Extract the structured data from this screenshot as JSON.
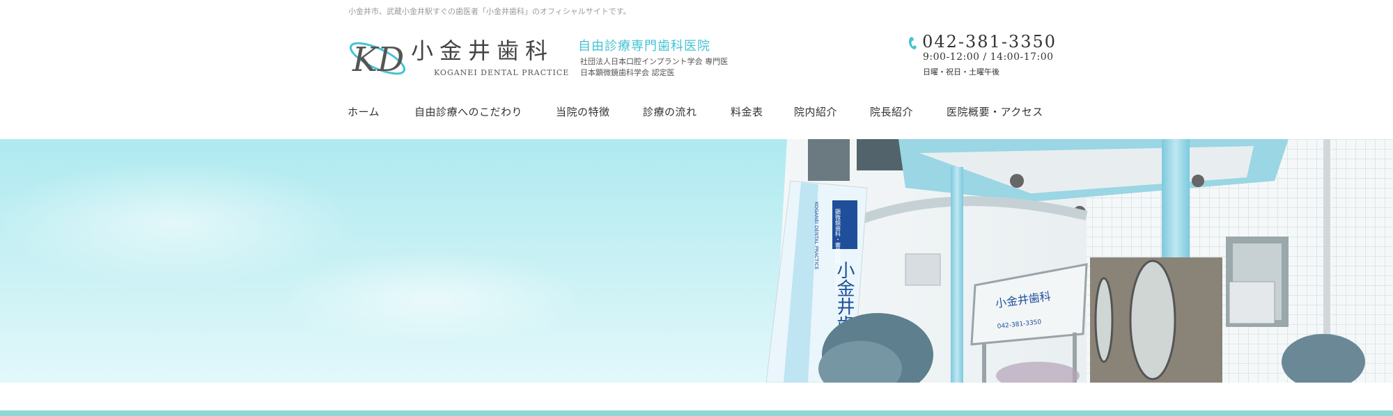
{
  "header": {
    "tagline": "小金井市、武蔵小金井駅すぐの歯医者「小金井歯科」のオフィシャルサイトです。",
    "logo_mark_text": "KD",
    "clinic_name": "小金井歯科",
    "clinic_name_en": "KOGANEI DENTAL PRACTICE",
    "slogan": "自由診療専門歯科医院",
    "cert_line1": "社団法人日本口腔インプラント学会 専門医",
    "cert_line2": "日本顕微鏡歯科学会 認定医",
    "phone": "042-381-3350",
    "hours": "9:00-12:00 / 14:00-17:00",
    "closed_days": "日曜・祝日・土曜午後"
  },
  "nav": {
    "items": [
      {
        "label": "ホーム"
      },
      {
        "label": "自由診療へのこだわり"
      },
      {
        "label": "当院の特徴"
      },
      {
        "label": "診療の流れ"
      },
      {
        "label": "料金表"
      },
      {
        "label": "院内紹介"
      },
      {
        "label": "院長紹介"
      },
      {
        "label": "医院概要・アクセス"
      }
    ]
  },
  "hero": {
    "sign_vertical": "小金井歯科",
    "sign_header": "顕微鏡歯科・審美歯科・予防歯科",
    "sign_en": "KOGANEI DENTAL PRACTICE",
    "board_title": "小金井歯科",
    "board_phone": "042-381-3350"
  },
  "colors": {
    "accent": "#45c3d4",
    "footer_bar": "#8fd6d6",
    "sky": "#bdeef2"
  }
}
